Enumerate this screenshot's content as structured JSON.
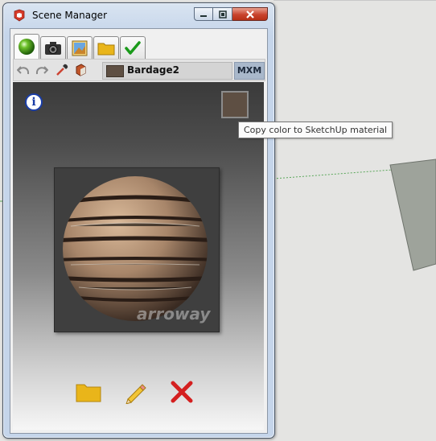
{
  "window": {
    "title": "Scene Manager"
  },
  "tabs": [
    {
      "icon": "green-sphere-icon"
    },
    {
      "icon": "camera-icon"
    },
    {
      "icon": "picture-icon"
    },
    {
      "icon": "folder-icon"
    },
    {
      "icon": "checkmark-icon"
    }
  ],
  "toolbar": {
    "material_name": "Bardage2",
    "engine_label": "MXM",
    "swatch_color": "#5e4f43"
  },
  "preview": {
    "watermark": "arroway",
    "info_label": "i"
  },
  "tooltip": {
    "text": "Copy color to SketchUp material"
  },
  "colors": {
    "accent": "#1a3da6",
    "close_red": "#c8432d",
    "folder_yellow": "#e9b51a"
  }
}
